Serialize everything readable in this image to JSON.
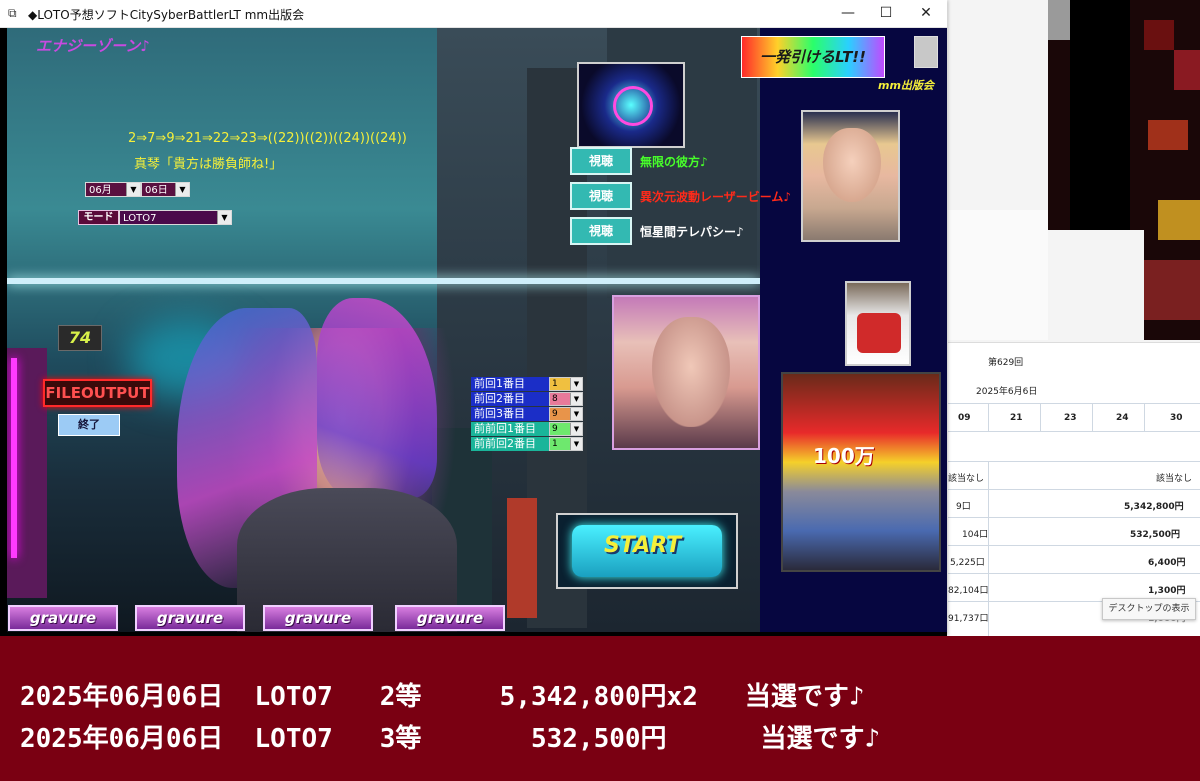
{
  "window": {
    "title": "◆LOTO予想ソフトCitySyberBattlerLT  mm出版会",
    "minimize": "—",
    "maximize": "☐",
    "close": "✕"
  },
  "app": {
    "energy_zone": "エナジーゾーン♪",
    "sequence": "2⇒7⇒9⇒21⇒22⇒23⇒((22))((2))((24))((24))",
    "quote": "真琴「貴方は勝負師ね!」",
    "month_select": "06月",
    "day_select": "06日",
    "mode_label": "モード",
    "mode_select": "LOTO7",
    "badge_74": "74",
    "file_output": "FILEOUTPUT",
    "exit_button": "終了",
    "start_button": "START",
    "watch_buttons": [
      {
        "label": "視聴",
        "title": "無限の彼方♪",
        "color": "#47ff2a"
      },
      {
        "label": "視聴",
        "title": "異次元波動レーザービーム♪",
        "color": "#ff2a1a"
      },
      {
        "label": "視聴",
        "title": "恒星間テレパシー♪",
        "color": "#ffffff"
      }
    ],
    "previous_rows": [
      {
        "label": "前回1番目",
        "value": "1",
        "bg": "#1b2ec7",
        "sel_bg": "#f0c040"
      },
      {
        "label": "前回2番目",
        "value": "8",
        "bg": "#1b2ec7",
        "sel_bg": "#e87a9a"
      },
      {
        "label": "前回3番目",
        "value": "9",
        "bg": "#1b2ec7",
        "sel_bg": "#e8944a"
      },
      {
        "label": "前前回1番目",
        "value": "9",
        "bg": "#1ab59a",
        "sel_bg": "#6ee86e"
      },
      {
        "label": "前前回2番目",
        "value": "1",
        "bg": "#1ab59a",
        "sel_bg": "#6ee86e"
      }
    ],
    "gravure_buttons": [
      "gravure",
      "gravure",
      "gravure",
      "gravure"
    ],
    "logo_text": "一発引けるLT!!",
    "logo_sub": "mm出版会",
    "pachinko_text": "100万"
  },
  "background_table": {
    "round": "第629回",
    "date": "2025年6月6日",
    "numbers": [
      "09",
      "21",
      "23",
      "24",
      "30"
    ],
    "rows": [
      {
        "count": "該当なし",
        "amount": "該当なし"
      },
      {
        "count": "9口",
        "amount": "5,342,800円"
      },
      {
        "count": "104口",
        "amount": "532,500円"
      },
      {
        "count": "5,225口",
        "amount": "6,400円"
      },
      {
        "count": "82,104口",
        "amount": "1,300円"
      },
      {
        "count": "91,737口",
        "amount": "1,000円"
      }
    ],
    "desktop_tip": "デスクトップの表示"
  },
  "banner": {
    "line1": "2025年06月06日  LOTO7   2等     5,342,800円x2   当選です♪",
    "line2": "2025年06月06日  LOTO7   3等       532,500円      当選です♪"
  }
}
